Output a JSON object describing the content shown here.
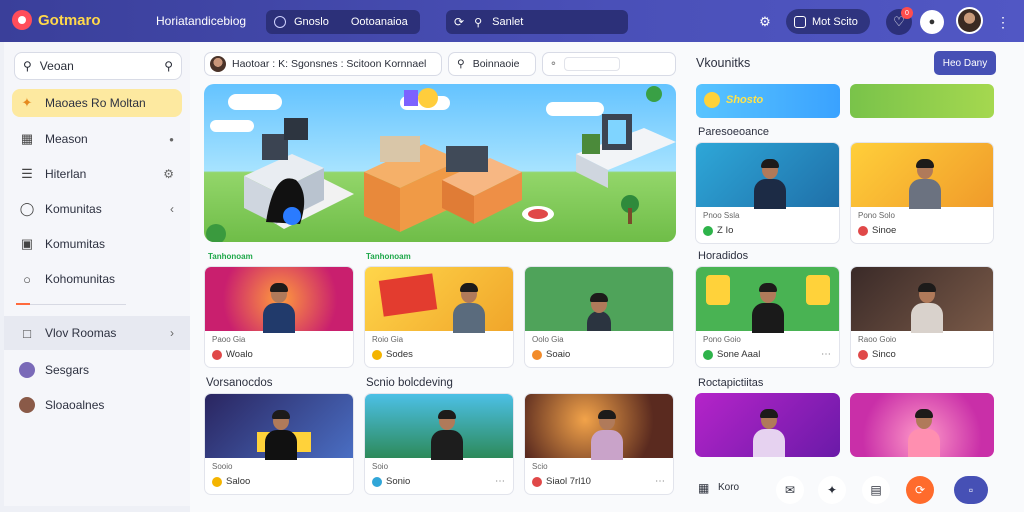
{
  "topbar": {
    "logo": "Gotmaro",
    "nav_title": "Horiatandicebiog",
    "pill_left": "Gnoslo",
    "pill_right": "Ootoanaioa",
    "search_text": "Sanlet",
    "cta_label": "Mot Scito",
    "notif_count": "0",
    "accent": "#ffd84a",
    "bar_color": "#4a50b8"
  },
  "sidebar": {
    "search_placeholder": "Veoan",
    "items": [
      {
        "label": "Maoaes Ro Moltan",
        "icon": "puzzle-icon"
      },
      {
        "label": "Meason",
        "icon": "grid-icon"
      },
      {
        "label": "Hiterlan",
        "icon": "list-icon"
      },
      {
        "label": "Komunitas",
        "icon": "chat-icon"
      },
      {
        "label": "Komumitas",
        "icon": "image-icon"
      },
      {
        "label": "Kohomunitas",
        "icon": "circle-icon"
      },
      {
        "label": "Vlov Roomas",
        "icon": "window-icon"
      },
      {
        "label": "Sesgars",
        "icon": "avatar"
      },
      {
        "label": "Sloaoalnes",
        "icon": "avatar"
      }
    ]
  },
  "main": {
    "crumb": "Haotoar : K: Sgonsnes : Scitoon Kornnael",
    "chip_two": "Boinnaoie",
    "section_green": "Tanhonoam",
    "section_two": "Vorsanocdos",
    "section_three": "Scnio bolcdeving",
    "row1": [
      {
        "sub": "Paoo Gia",
        "title": "Woalo",
        "dot": "#e04848"
      },
      {
        "sub": "Roio Gia",
        "title": "Sodes",
        "dot": "#f4b400"
      },
      {
        "sub": "Oolo Gia",
        "title": "Soaio",
        "dot": "#f28b2a"
      }
    ],
    "row2": [
      {
        "sub": "Sooio",
        "title": "Saloo",
        "dot": "#f4b400"
      },
      {
        "sub": "Soio",
        "title": "Sonio",
        "dot": "#31a6d8"
      },
      {
        "sub": "Scio",
        "title": "Siaol 7rl10",
        "dot": "#e04848"
      }
    ]
  },
  "right": {
    "title": "Vkounitks",
    "button": "Heo Dany",
    "section_a": "Paresoeoance",
    "section_b": "Horadidos",
    "section_c": "Roctapictiitas",
    "banner_a": "Shosto",
    "cards_a": [
      {
        "sub": "Pnoo Ssla",
        "title": "Z Io",
        "dot": "#2eb34a"
      },
      {
        "sub": "Pono Solo",
        "title": "Sinoe",
        "dot": "#e04848"
      }
    ],
    "cards_b": [
      {
        "sub": "Pono Goio",
        "title": "Sone Aaal",
        "dot": "#2eb34a"
      },
      {
        "sub": "Raoo Goio",
        "title": "Sinco",
        "dot": "#e04848"
      }
    ],
    "bottom_label": "Koro"
  }
}
